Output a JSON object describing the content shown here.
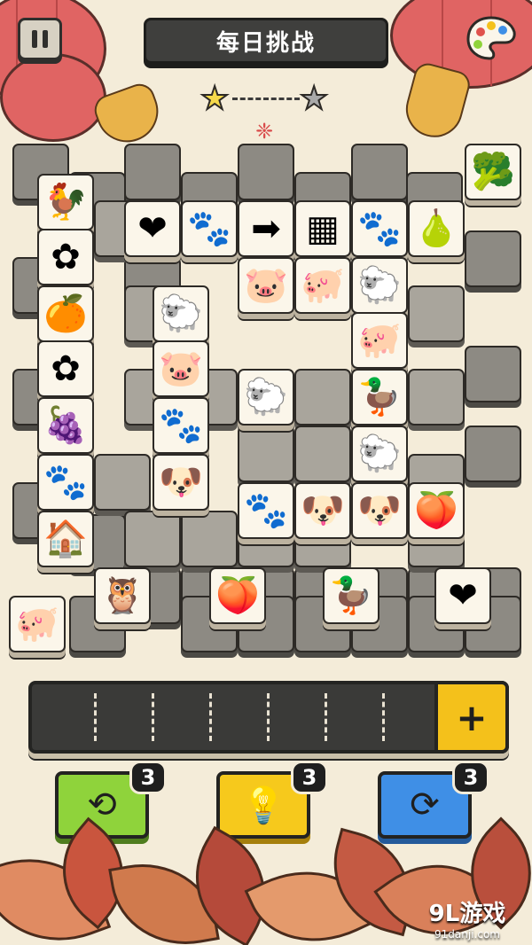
{
  "header": {
    "title": "每日挑战",
    "pause_icon": "pause-icon",
    "palette_icon": "palette-icon"
  },
  "progress": {
    "stars_earned": 1,
    "stars_total": 2,
    "earned_color": "#f6d94a",
    "empty_color": "#a9a9a9"
  },
  "board": {
    "front_tiles": [
      {
        "icon": "rooster",
        "glyph": "🐓"
      },
      {
        "icon": "heart",
        "glyph": "❤"
      },
      {
        "icon": "paw",
        "glyph": "🐾"
      },
      {
        "icon": "sign",
        "glyph": "➡"
      },
      {
        "icon": "crate",
        "glyph": "▦"
      },
      {
        "icon": "paw",
        "glyph": "🐾"
      },
      {
        "icon": "pear",
        "glyph": "🍐"
      },
      {
        "icon": "broccoli",
        "glyph": "🥦"
      },
      {
        "icon": "flower",
        "glyph": "✿"
      },
      {
        "icon": "pig",
        "glyph": "🐷"
      },
      {
        "icon": "pig-body",
        "glyph": "🐖"
      },
      {
        "icon": "sheep",
        "glyph": "🐑"
      },
      {
        "icon": "orange",
        "glyph": "🍊"
      },
      {
        "icon": "sheep",
        "glyph": "🐑"
      },
      {
        "icon": "flower",
        "glyph": "✿"
      },
      {
        "icon": "pig",
        "glyph": "🐷"
      },
      {
        "icon": "pig-body",
        "glyph": "🐖"
      },
      {
        "icon": "sheep-body",
        "glyph": "🐑"
      },
      {
        "icon": "duck",
        "glyph": "🦆"
      },
      {
        "icon": "grapes",
        "glyph": "🍇"
      },
      {
        "icon": "footprints",
        "glyph": "🐾"
      },
      {
        "icon": "sheep-body",
        "glyph": "🐑"
      },
      {
        "icon": "footprints",
        "glyph": "🐾"
      },
      {
        "icon": "dog",
        "glyph": "🐶"
      },
      {
        "icon": "footprints",
        "glyph": "🐾"
      },
      {
        "icon": "dog",
        "glyph": "🐶"
      },
      {
        "icon": "dog",
        "glyph": "🐶"
      },
      {
        "icon": "peach",
        "glyph": "🍑"
      },
      {
        "icon": "house",
        "glyph": "🏠"
      },
      {
        "icon": "owl",
        "glyph": "🦉"
      },
      {
        "icon": "peach",
        "glyph": "🍑"
      },
      {
        "icon": "duck",
        "glyph": "🦆"
      },
      {
        "icon": "heart",
        "glyph": "❤"
      },
      {
        "icon": "pig-body",
        "glyph": "🐖"
      }
    ]
  },
  "tray": {
    "slots": 7,
    "add_label": "+"
  },
  "powerups": [
    {
      "name": "undo",
      "icon": "clock-undo-icon",
      "glyph": "⟲",
      "count": "3",
      "color": "#8fd33b"
    },
    {
      "name": "hint",
      "icon": "lightbulb-icon",
      "glyph": "💡",
      "count": "3",
      "color": "#f6c91c"
    },
    {
      "name": "shuffle",
      "icon": "shuffle-icon",
      "glyph": "⟳",
      "count": "3",
      "color": "#3f8fe6"
    }
  ],
  "watermark": {
    "logo": "9L游戏",
    "url": "91danji.com"
  }
}
